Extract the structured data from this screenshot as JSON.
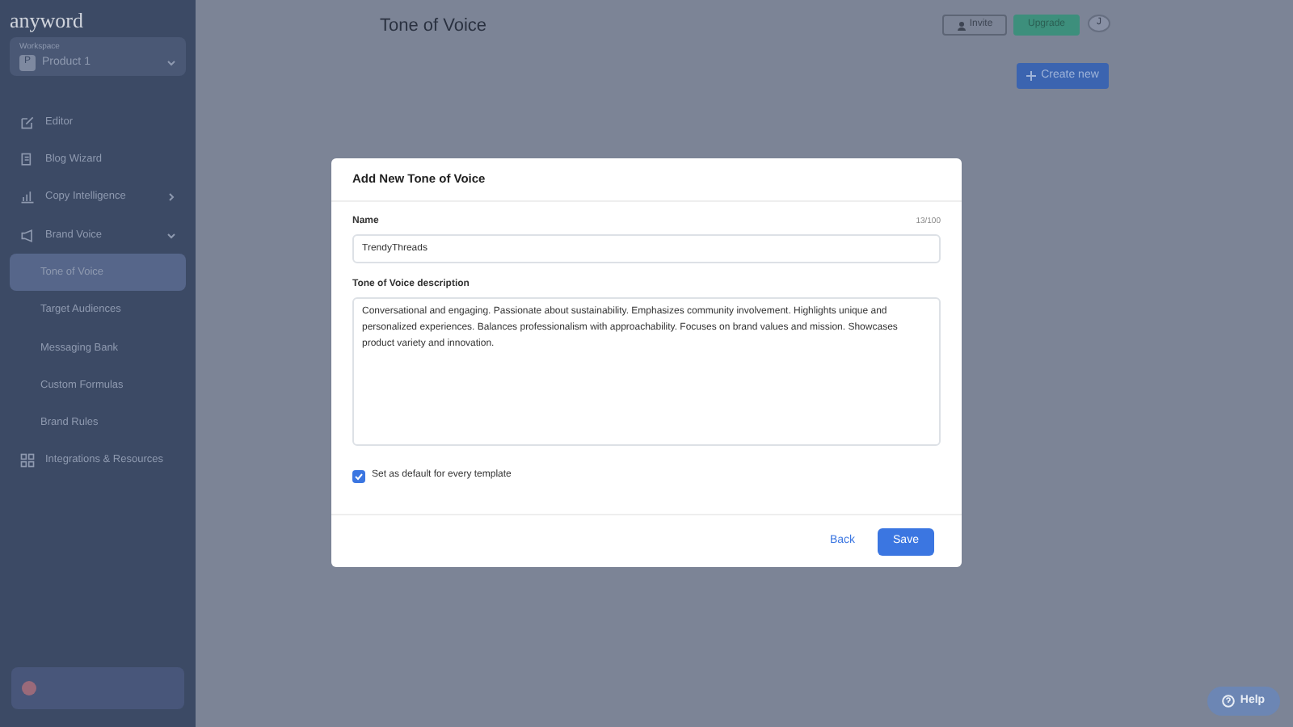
{
  "logo": "anyword",
  "workspace": {
    "label": "Workspace",
    "avatar": "P",
    "name": "Product 1"
  },
  "sidebar": {
    "items": [
      {
        "label": "Editor",
        "selected": false
      },
      {
        "label": "Blog Wizard",
        "selected": false
      },
      {
        "label": "Copy Intelligence",
        "expanded": false,
        "selected": false
      },
      {
        "label": "Brand Voice",
        "expanded": true,
        "selected": false,
        "children": [
          {
            "label": "Tone of Voice",
            "selected": true
          },
          {
            "label": "Target Audiences",
            "selected": false
          },
          {
            "label": "Messaging Bank",
            "selected": false
          },
          {
            "label": "Custom Formulas",
            "selected": false
          },
          {
            "label": "Brand Rules",
            "selected": false
          }
        ]
      },
      {
        "label": "Integrations & Resources",
        "selected": false
      }
    ]
  },
  "header": {
    "title": "Tone of Voice",
    "invite": "Invite",
    "upgrade": "Upgrade",
    "user_initial": "J"
  },
  "create_button": "Create new",
  "dialog": {
    "title": "Add New Tone of Voice",
    "name_label": "Name",
    "name_counter": "13/100",
    "name_value": "TrendyThreads",
    "description_label": "Tone of Voice description",
    "description_value": "Conversational and engaging. Passionate about sustainability. Emphasizes community involvement. Highlights unique and personalized experiences. Balances professionalism with approachability. Focuses on brand values and mission. Showcases product variety and innovation.",
    "default_checkbox": {
      "label": "Set as default for every template",
      "checked": true
    },
    "back": "Back",
    "save": "Save"
  },
  "help": "Help"
}
